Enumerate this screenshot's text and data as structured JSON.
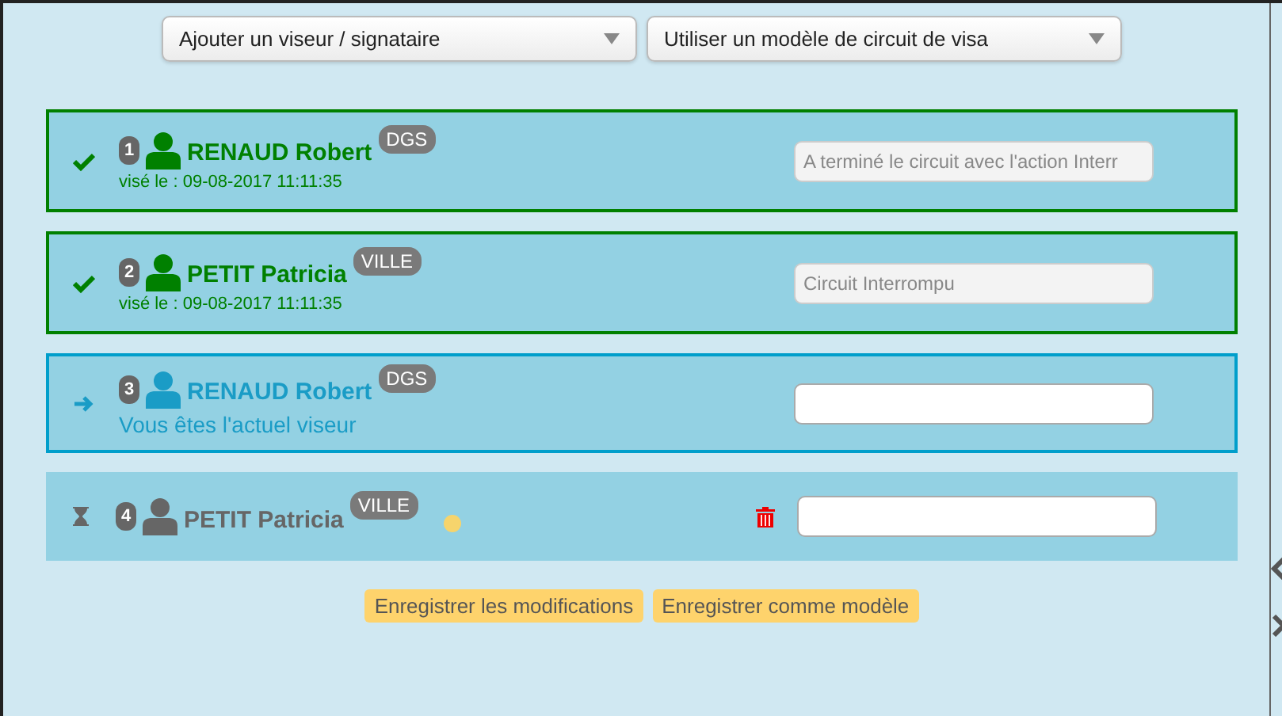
{
  "selects": [
    {
      "label": "Ajouter un viseur / signataire"
    },
    {
      "label": "Utiliser un modèle de circuit de visa"
    }
  ],
  "visors": [
    {
      "kind": "done",
      "number": "1",
      "name": "RENAUD Robert",
      "tag": "DGS",
      "note": "visé le : 09-08-2017 11:11:35",
      "comment": "A terminé le circuit avec l'action Interr",
      "disabled": true,
      "deletable": false,
      "waiting_dot": false
    },
    {
      "kind": "done",
      "number": "2",
      "name": "PETIT Patricia",
      "tag": "VILLE",
      "note": "visé le : 09-08-2017 11:11:35",
      "comment": "Circuit Interrompu",
      "disabled": true,
      "deletable": false,
      "waiting_dot": false
    },
    {
      "kind": "current",
      "number": "3",
      "name": "RENAUD Robert",
      "tag": "DGS",
      "note": "Vous êtes l'actuel viseur",
      "disabled": false,
      "deletable": false,
      "waiting_dot": false
    },
    {
      "kind": "pending",
      "number": "4",
      "name": "PETIT Patricia",
      "tag": "VILLE",
      "disabled": false,
      "deletable": true,
      "waiting_dot": true
    }
  ],
  "buttons": [
    "Enregistrer les modifications",
    "Enregistrer comme modèle"
  ]
}
